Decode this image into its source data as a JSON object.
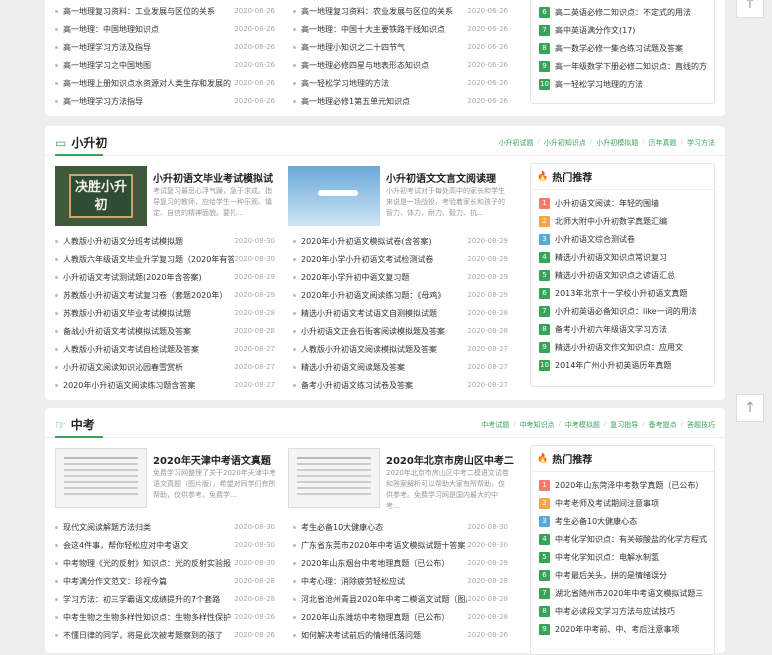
{
  "top_section": {
    "left_list": [
      {
        "title": "高一地理复习资料：工业发展与区位的关系",
        "date": "2020-06-26"
      },
      {
        "title": "高一地理：中国地理知识点",
        "date": "2020-06-26"
      },
      {
        "title": "高一地理学习方法及指导",
        "date": "2020-06-26"
      },
      {
        "title": "高一地理学习之中国地图",
        "date": "2020-06-26"
      },
      {
        "title": "高一地理上册知识点水资源对人类生存和发展的",
        "date": "2020-06-26"
      },
      {
        "title": "高一地理学习方法指导",
        "date": "2020-06-26"
      }
    ],
    "right_list": [
      {
        "title": "高一地理复习资料：农业发展与区位的关系",
        "date": "2020-06-26"
      },
      {
        "title": "高一地理：中国十大主要铁路干线知识点",
        "date": "2020-06-26"
      },
      {
        "title": "高一地理小知识之二十四节气",
        "date": "2020-06-26"
      },
      {
        "title": "高一地理必修四星与地表形态知识点",
        "date": "2020-06-26"
      },
      {
        "title": "高一轻松学习地理的方法",
        "date": "2020-06-26"
      },
      {
        "title": "高一地理必修1第五单元知识点",
        "date": "2020-06-26"
      }
    ],
    "hot": [
      {
        "n": "6",
        "title": "高二英语必修二知识点：不定式的用法"
      },
      {
        "n": "7",
        "title": "高中英语满分作文(17)"
      },
      {
        "n": "8",
        "title": "高一数学必修一集合练习试题及答案"
      },
      {
        "n": "9",
        "title": "高一年级数学下册必修二知识点：直线的方"
      },
      {
        "n": "10",
        "title": "高一轻松学习地理的方法"
      }
    ]
  },
  "xsc": {
    "title": "小升初",
    "links": [
      "小升初试题",
      "小升初知识点",
      "小升初模拟题",
      "历年真题",
      "学习方法"
    ],
    "feature1": {
      "title": "小升初语文毕业考试模拟试",
      "desc": "考试复习最忌心浮气躁，急于求成。指导复习的教师，应给学生一种乐观、镇定、自信的精神面貌。要扎…",
      "img_text": "决胜小升初"
    },
    "feature2": {
      "title": "小升初语文文言文阅读理",
      "desc": "小升初考试对于每处高中的家长和学生来说是一场战役，考验着家长和孩子的智力、体力、耐力、毅力、抗…"
    },
    "left_list": [
      {
        "title": "人教版小升初语文分班考试模拟题",
        "date": "2020-08-30"
      },
      {
        "title": "人教版六年级语文毕业升学复习题（2020年有答",
        "date": "2020-08-30"
      },
      {
        "title": "小升初语文考试测试题(2020年含答案)",
        "date": "2020-08-29"
      },
      {
        "title": "苏教版小升初语文考试复习卷（套题2020年）",
        "date": "2020-08-29"
      },
      {
        "title": "苏教版小升初语文毕业考试模拟试题",
        "date": "2020-08-28"
      },
      {
        "title": "备战小升初语文考试模拟试题及答案",
        "date": "2020-08-28"
      },
      {
        "title": "人教版小升初语文考试自检试题及答案",
        "date": "2020-08-27"
      },
      {
        "title": "小升初语文阅读知识沁园春雪赏析",
        "date": "2020-08-27"
      },
      {
        "title": "2020年小升初语文阅读练习题含答案",
        "date": "2020-08-27"
      }
    ],
    "right_list": [
      {
        "title": "2020年小升初语文模拟试卷(含答案)",
        "date": "2020-08-29"
      },
      {
        "title": "2020年小学小升初语文考试检测试卷",
        "date": "2020-08-29"
      },
      {
        "title": "2020年小学升初中语文复习题",
        "date": "2020-08-29"
      },
      {
        "title": "2020年小升初语文阅读练习题：《母鸡》",
        "date": "2020-08-29"
      },
      {
        "title": "精选小升初语文考试语文自测模拟试题",
        "date": "2020-08-28"
      },
      {
        "title": "小升初语文正会石街客阅读模拟题及答案",
        "date": "2020-08-28"
      },
      {
        "title": "人教版小升初语文阅读模拟试题及答案",
        "date": "2020-08-27"
      },
      {
        "title": "精选小升初语文阅读题及答案",
        "date": "2020-08-27"
      },
      {
        "title": "备考小升初语文练习试卷及答案",
        "date": "2020-08-27"
      }
    ],
    "hot_title": "热门推荐",
    "hot": [
      {
        "n": "1",
        "title": "小升初语文阅读：年轻的围墙"
      },
      {
        "n": "2",
        "title": "北师大附中小升初数学真题汇编"
      },
      {
        "n": "3",
        "title": "小升初语文综合测试卷"
      },
      {
        "n": "4",
        "title": "精选小升初语文知识点常识复习"
      },
      {
        "n": "5",
        "title": "精选小升初语文知识点之谚语汇总"
      },
      {
        "n": "6",
        "title": "2013年北京十一学校小升初语文真题"
      },
      {
        "n": "7",
        "title": "小升初英语必备知识点：like一词的用法"
      },
      {
        "n": "8",
        "title": "备考小升初六年级语文学习方法"
      },
      {
        "n": "9",
        "title": "精选小升初语文作文知识点：应用文"
      },
      {
        "n": "10",
        "title": "2014年广州小升初英语历年真题"
      }
    ]
  },
  "zk": {
    "title": "中考",
    "links": [
      "中考试题",
      "中考知识点",
      "中考模拟题",
      "复习指导",
      "备考提点",
      "答题技巧"
    ],
    "feature1": {
      "title": "2020年天津中考语文真题",
      "desc": "免费学习网整理了关于2020年天津中考语文真题（图片版），希望对同学们有所帮助，仅供参考。免费学…"
    },
    "feature2": {
      "title": "2020年北京市房山区中考二",
      "desc": "2020年北京市房山区中考二模语文试卷和答案解析可以帮助大家有所帮助，仅供参考。免费学习网是国内最大的中考…"
    },
    "left_list": [
      {
        "title": "现代文阅读解题方法归类",
        "date": "2020-08-30"
      },
      {
        "title": "会这4件事，帮你轻松应对中考语文",
        "date": "2020-08-30"
      },
      {
        "title": "中考物理《光的反射》知识点：光的反射实验报",
        "date": "2020-08-30"
      },
      {
        "title": "中考满分作文范文：珍视今篇",
        "date": "2020-08-28"
      },
      {
        "title": "学习方法：初三学霸语文成绩提升的7个套路",
        "date": "2020-08-28"
      },
      {
        "title": "中考生物之生物多样性知识点：生物多样性保护",
        "date": "2020-08-26"
      },
      {
        "title": "不懂日律的同学，将是此次被考题察到的孩了",
        "date": "2020-08-26"
      }
    ],
    "right_list": [
      {
        "title": "考生必备10大健康心态",
        "date": "2020-08-30"
      },
      {
        "title": "广东省东莞市2020年中考语文模拟试题十答案",
        "date": "2020-08-30"
      },
      {
        "title": "2020年山东烟台中考地理真题（已公布）",
        "date": "2020-08-29"
      },
      {
        "title": "中考心理：消除疲劳轻松应试",
        "date": "2020-08-28"
      },
      {
        "title": "河北省沧州青县2020年中考二模语文试题（图片",
        "date": "2020-08-28"
      },
      {
        "title": "2020年山东潍坊中考物理真题（已公布）",
        "date": "2020-08-28"
      },
      {
        "title": "如何解决考试前后的情绪低落问题",
        "date": "2020-08-26"
      }
    ],
    "hot_title": "热门推荐",
    "hot": [
      {
        "n": "1",
        "title": "2020年山东菏泽中考数学真题（已公布）"
      },
      {
        "n": "2",
        "title": "中考老师及考试期间注意事项"
      },
      {
        "n": "3",
        "title": "考生必备10大健康心态"
      },
      {
        "n": "4",
        "title": "中考化学知识点：有关碳酸盐的化学方程式"
      },
      {
        "n": "5",
        "title": "中考化学知识点：电解水制氢"
      },
      {
        "n": "6",
        "title": "中考最后关头，拼的是情绪误分"
      },
      {
        "n": "7",
        "title": "湖北省随州市2020年中考语文模拟试题三"
      },
      {
        "n": "8",
        "title": "中考必读段文学习方法与应试技巧"
      },
      {
        "n": "9",
        "title": "2020年中考前、中、考后注意事项"
      }
    ]
  },
  "side": {
    "top_label": "返回顶部",
    "arrow_icon": "arrow-up-icon"
  }
}
